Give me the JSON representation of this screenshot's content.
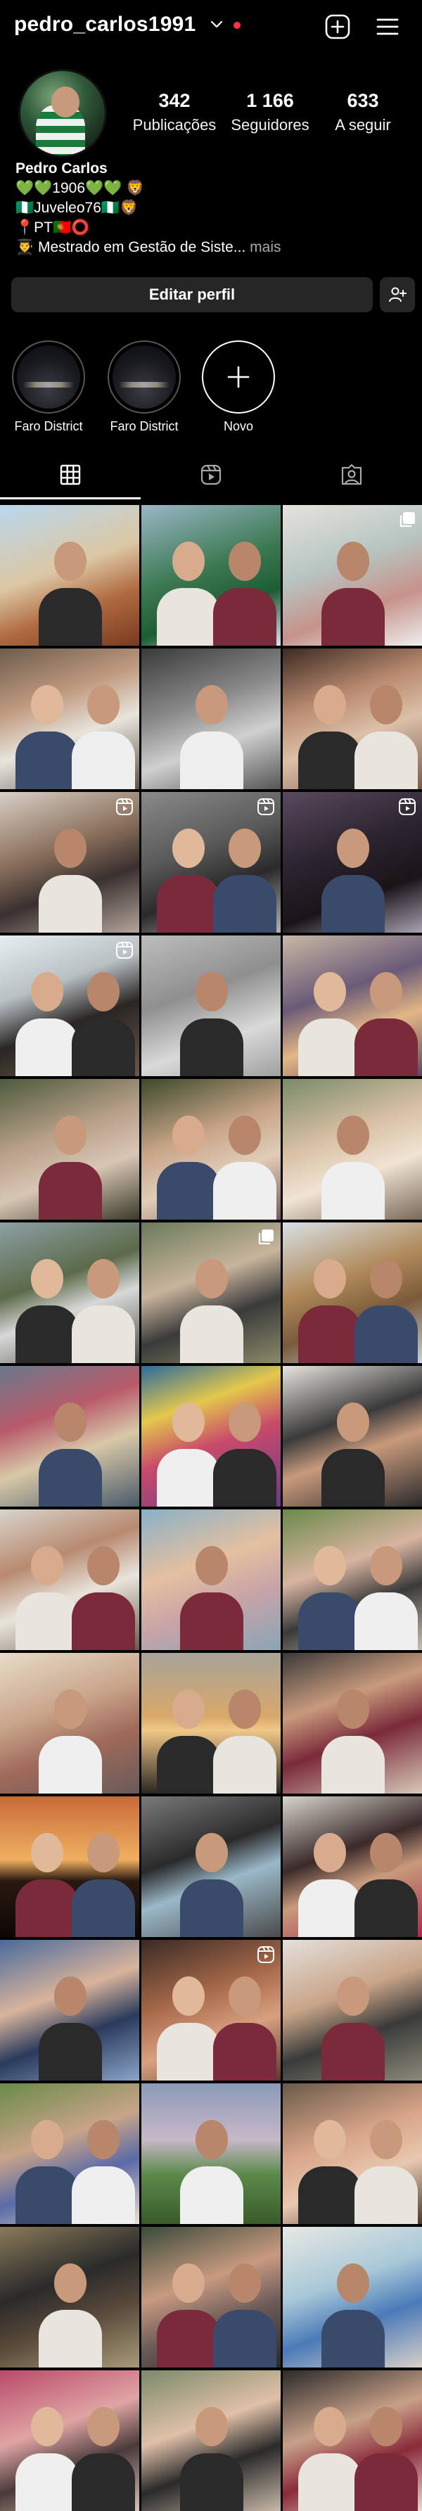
{
  "header": {
    "username": "pedro_carlos1991"
  },
  "profile": {
    "stats": [
      {
        "num": "342",
        "label": "Publicações"
      },
      {
        "num": "1 166",
        "label": "Seguidores"
      },
      {
        "num": "633",
        "label": "A seguir"
      }
    ],
    "bio": {
      "name": "Pedro Carlos",
      "line1": "💚💚1906💚💚 🦁",
      "line2": "🇳🇬Juveleo76🇳🇬🦁",
      "line3": "📍PT🇵🇹⭕",
      "line4": "👨‍🎓 Mestrado em Gestão de Siste...",
      "more": "mais"
    },
    "edit_label": "Editar perfil"
  },
  "highlights": [
    {
      "label": "Faro District"
    },
    {
      "label": "Faro District"
    },
    {
      "label": "Novo"
    }
  ],
  "tabs": [
    {
      "name": "posts-grid",
      "icon": "grid-icon"
    },
    {
      "name": "reels",
      "icon": "reels-icon"
    },
    {
      "name": "tagged",
      "icon": "tagged-icon"
    }
  ],
  "grid": [
    {
      "bg": "linear-gradient(160deg,#b9d7ee 0%,#dcc7a4 45%,#b06a3f 70%,#7a3a22 100%)",
      "badge": ""
    },
    {
      "bg": "linear-gradient(160deg,#9ab6c6 0%,#3d7a54 45%,#1c5c34 70%,#d8e4ea 100%)",
      "badge": ""
    },
    {
      "bg": "linear-gradient(160deg,#e6e2dc 0%,#b8c6c3 40%,#c6928a 70%,#eee 100%)",
      "badge": "carousel"
    },
    {
      "bg": "linear-gradient(160deg,#6d5c4c 0%,#c09a80 35%,#e8e4dc 60%,#5e5349 100%)",
      "badge": ""
    },
    {
      "bg": "linear-gradient(160deg,#3a3a3a 0%,#8a8a8a 40%,#d0d0d0 65%,#555 100%)",
      "badge": ""
    },
    {
      "bg": "linear-gradient(160deg,#3c2a22 0%,#b88a70 35%,#dcc0a8 60%,#7c5a4a 100%)",
      "badge": ""
    },
    {
      "bg": "linear-gradient(160deg,#d8cfc6 0%,#8a705c 40%,#3a3030 65%,#b4a59a 100%)",
      "badge": "reels"
    },
    {
      "bg": "linear-gradient(160deg,#8a8a8a 0%,#5a5a5a 40%,#2a2a2a 65%,#b4b4b4 100%)",
      "badge": "reels"
    },
    {
      "bg": "linear-gradient(160deg,#5a4a5e 0%,#2c2430 40%,#1a1418 70%,#a8a2b2 100%)",
      "badge": "reels"
    },
    {
      "bg": "linear-gradient(160deg,#e7eef2 0%,#b8c0c4 35%,#2a2624 60%,#6b5a48 100%)",
      "badge": "reels"
    },
    {
      "bg": "linear-gradient(160deg,#bdbdbd 0%,#8f8f8f 40%,#d9d9d9 70%,#a0a0a0 100%)",
      "badge": ""
    },
    {
      "bg": "linear-gradient(160deg,#c8b8a4 0%,#6a5a78 40%,#e3b686 65%,#5b4860 100%)",
      "badge": ""
    },
    {
      "bg": "linear-gradient(160deg,#4d5a3c 0%,#b8a08a 40%,#d8c6b4 65%,#3a3a2a 100%)",
      "badge": ""
    },
    {
      "bg": "linear-gradient(160deg,#3c4a2a 0%,#c8a488 40%,#e0cdb8 65%,#7a5a5a 100%)",
      "badge": ""
    },
    {
      "bg": "linear-gradient(160deg,#7a8a6a 0%,#d8c0a4 40%,#f0e4d4 65%,#7a6a58 100%)",
      "badge": ""
    },
    {
      "bg": "linear-gradient(160deg,#8ca0a4 0%,#5c6a4a 40%,#d8d8d8 60%,#4a4a40 100%)",
      "badge": ""
    },
    {
      "bg": "linear-gradient(160deg,#6a7a5a 0%,#c8b49c 40%,#3a3a3a 65%,#8a8a6a 100%)",
      "badge": "carousel"
    },
    {
      "bg": "linear-gradient(160deg,#d8e0e6 0%,#b08a5a 40%,#7a5a3a 65%,#c8d0d6 100%)",
      "badge": ""
    },
    {
      "bg": "linear-gradient(160deg,#6a7a8c 0%,#b85a6a 35%,#d8c8a8 60%,#4a5a6a 100%)",
      "badge": ""
    },
    {
      "bg": "linear-gradient(160deg,#2c6a9c 0%,#e4c84c 30%,#c84a6a 55%,#6a3a8a 100%)",
      "badge": ""
    },
    {
      "bg": "linear-gradient(160deg,#e8e4de 0%,#3a3a3a 40%,#c89a7c 60%,#2a2a2a 100%)",
      "badge": ""
    },
    {
      "bg": "linear-gradient(160deg,#d8d4cc 0%,#b88a70 35%,#e8e4dc 60%,#6a5a4a 100%)",
      "badge": ""
    },
    {
      "bg": "linear-gradient(160deg,#8ab0c8 0%,#e4c0a0 40%,#c8a4a8 65%,#8aa4b8 100%)",
      "badge": ""
    },
    {
      "bg": "linear-gradient(160deg,#6a8a4a 0%,#d8b4a0 40%,#3a3a3a 65%,#c8c0b0 100%)",
      "badge": ""
    },
    {
      "bg": "linear-gradient(160deg,#e8dcc8 0%,#c8a48a 40%,#a06a5a 65%,#6a5a5a 100%)",
      "badge": ""
    },
    {
      "bg": "linear-gradient(180deg,#a8a49a 0%,#d8a86a 45%,#f0c888 55%,#2a2620 100%)",
      "badge": ""
    },
    {
      "bg": "linear-gradient(160deg,#3a3a3a 0%,#c89a7c 35%,#7a2a3a 60%,#d8c8b8 100%)",
      "badge": ""
    },
    {
      "bg": "linear-gradient(180deg,#c86a3a 0%,#f0b060 45%,#2a1810 60%,#0c0806 100%)",
      "badge": ""
    },
    {
      "bg": "linear-gradient(160deg,#7a7a7a 0%,#2a2a2a 40%,#9ab8c8 60%,#4a4a4a 100%)",
      "badge": ""
    },
    {
      "bg": "linear-gradient(160deg,#d8d4cc 0%,#3a2a2a 40%,#c89a7c 60%,#a82a4a 100%)",
      "badge": ""
    },
    {
      "bg": "linear-gradient(160deg,#4a6a9c 0%,#d8b49c 40%,#2a3a5c 65%,#8aa4c8 100%)",
      "badge": ""
    },
    {
      "bg": "linear-gradient(160deg,#3a2a24 0%,#a86a4a 40%,#d8a080 65%,#5a3a2a 100%)",
      "badge": "reels"
    },
    {
      "bg": "linear-gradient(160deg,#e4e0dc 0%,#c8a488 40%,#3a3a3a 65%,#8a8a7a 100%)",
      "badge": ""
    },
    {
      "bg": "linear-gradient(160deg,#6a8a4a 0%,#c8a488 40%,#5a6aa8 65%,#f0e0c8 100%)",
      "badge": ""
    },
    {
      "bg": "linear-gradient(180deg,#8a9ab8 0%,#c8b8c8 40%,#5a8a4a 65%,#3a5a2a 100%)",
      "badge": ""
    },
    {
      "bg": "linear-gradient(160deg,#6a5a4a 0%,#d8a488 40%,#e8c8b0 65%,#4a3a2a 100%)",
      "badge": ""
    },
    {
      "bg": "linear-gradient(160deg,#8a7a5a 0%,#2a2a2a 40%,#5a4a3a 65%,#a89a7a 100%)",
      "badge": ""
    },
    {
      "bg": "linear-gradient(160deg,#3a4a3a 0%,#c89a80 40%,#6a5a58 65%,#2a2a2a 100%)",
      "badge": ""
    },
    {
      "bg": "linear-gradient(160deg,#e8e8e4 0%,#a8c8d8 40%,#4a7ab8 65%,#d8d0c8 100%)",
      "badge": ""
    },
    {
      "bg": "linear-gradient(160deg,#b84a6a 0%,#e0a4a4 40%,#4a3a3a 65%,#d8c0b4 100%)",
      "badge": ""
    },
    {
      "bg": "linear-gradient(160deg,#7a8a6a 0%,#e0c0a8 40%,#2a2a2a 65%,#c8b8a8 100%)",
      "badge": ""
    },
    {
      "bg": "linear-gradient(160deg,#2a2a2a 0%,#c8a088 40%,#8a2a3a 65%,#e8dcd0 100%)",
      "badge": ""
    }
  ]
}
